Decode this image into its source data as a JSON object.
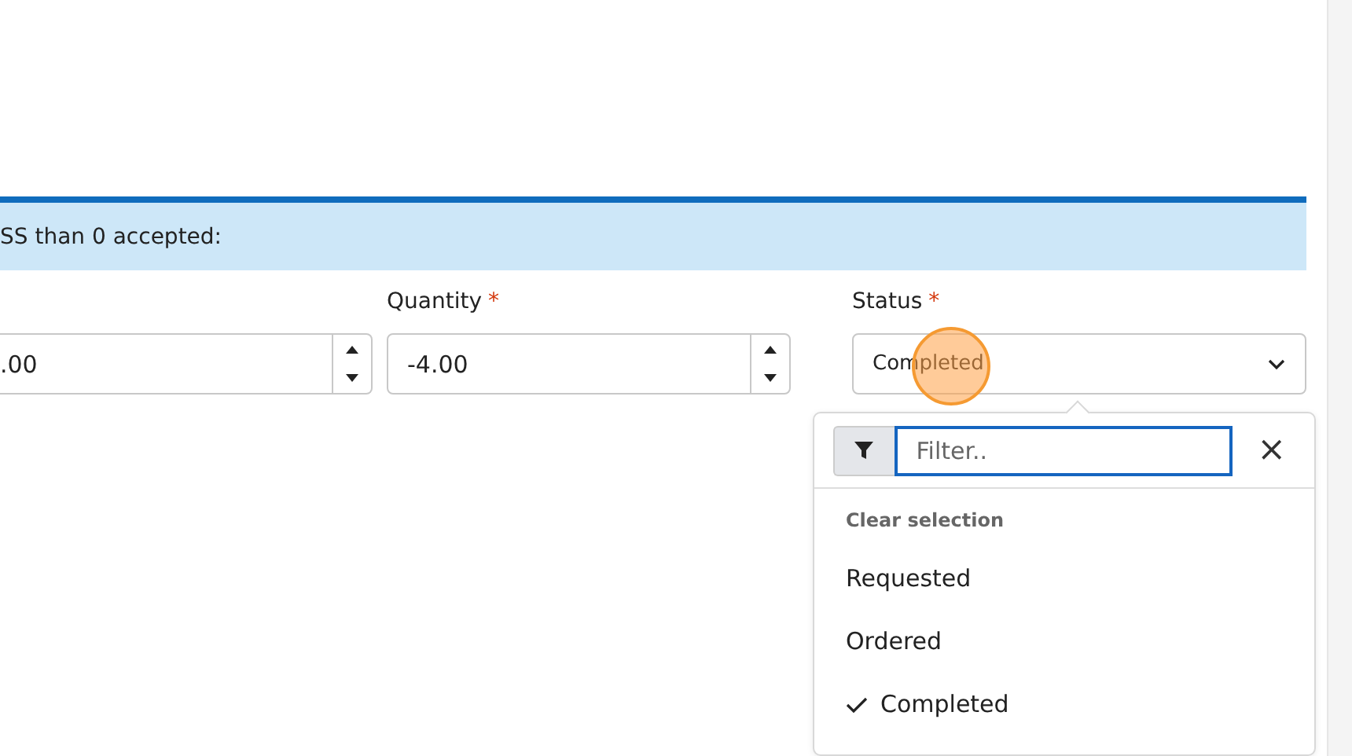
{
  "banner": {
    "text": "SS than 0 accepted:"
  },
  "fields": [
    {
      "kind": "number",
      "value": ".00"
    },
    {
      "kind": "number",
      "label": "Quantity",
      "value": "-4.00",
      "required_mark": "*"
    },
    {
      "kind": "select",
      "label": "Status",
      "value": "Completed",
      "required_mark": "*"
    }
  ],
  "dropdown": {
    "filter_placeholder": "Filter..",
    "clear_label": "Clear selection",
    "close_symbol": "×",
    "options": [
      {
        "label": "Requested",
        "selected": false
      },
      {
        "label": "Ordered",
        "selected": false
      },
      {
        "label": "Completed",
        "selected": true
      }
    ]
  }
}
